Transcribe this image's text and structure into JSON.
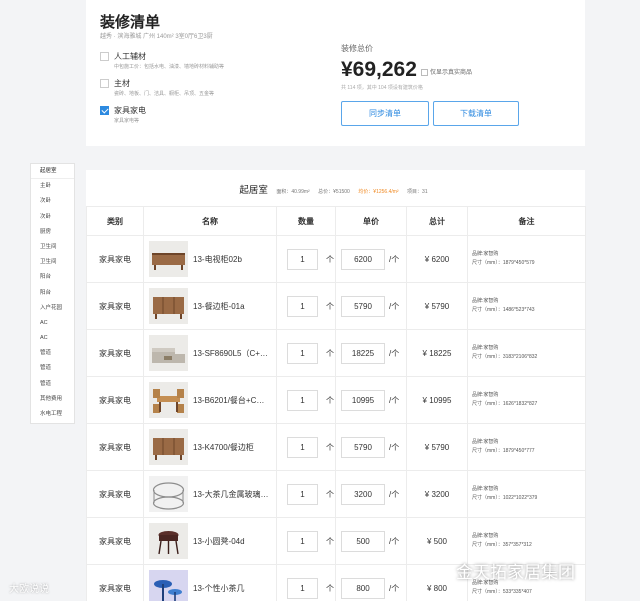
{
  "summary": {
    "title": "装修清单",
    "subtitle": "越秀 · 滨海雅城 广州 140m² 3室0厅6卫3厨",
    "options": [
      {
        "label": "人工辅材",
        "desc": "中包施工价：包括水电、油漆、墙地砖材料辅助等",
        "checked": false
      },
      {
        "label": "主材",
        "desc": "瓷砖、地板、门、洁具、橱柜、吊顶、五金等",
        "checked": false
      },
      {
        "label": "家具家电",
        "desc": "家具家电等",
        "checked": true
      }
    ],
    "total_label": "装修总价",
    "total_amount": "¥69,262",
    "show_real_label": "仅显示真实商品",
    "total_note": "共 114 项，其中 104 项设有建筑价格",
    "sync_button": "同步清单",
    "order_button": "下载清单"
  },
  "sidebar": {
    "items": [
      "起居室",
      "主卧",
      "次卧",
      "次卧",
      "厨房",
      "卫生间",
      "卫生间",
      "阳台",
      "阳台",
      "入户花园",
      "AC",
      "AC",
      "管道",
      "管道",
      "管道",
      "其他费用",
      "水电工程"
    ]
  },
  "room": {
    "title": "起居室",
    "area": "面积：40.99m²",
    "total": "总价：¥51500",
    "unit_price": "均价：¥1256.4/m²",
    "items_count": "项目：31"
  },
  "table": {
    "headers": [
      "类别",
      "名称",
      "数量",
      "单价",
      "总计",
      "备注"
    ],
    "rows": [
      {
        "category": "家具家电",
        "name": "13-电视柜02b",
        "qty": "1",
        "qty_unit": "个",
        "price": "6200",
        "price_unit": "/个",
        "total": "¥ 6200",
        "brand": "品牌:家智购",
        "size": "尺寸（mm）：1879*450*579",
        "thumb": "tv-cabinet"
      },
      {
        "category": "家具家电",
        "name": "13-餐边柜-01a",
        "qty": "1",
        "qty_unit": "个",
        "price": "5790",
        "price_unit": "/个",
        "total": "¥ 5790",
        "brand": "品牌:家智购",
        "size": "尺寸（mm）：1486*523*743",
        "thumb": "sideboard"
      },
      {
        "category": "家具家电",
        "name": "13-SF8690L5（C+…",
        "qty": "1",
        "qty_unit": "个",
        "price": "18225",
        "price_unit": "/个",
        "total": "¥ 18225",
        "brand": "品牌:家智购",
        "size": "尺寸（mm）：3183*2106*832",
        "thumb": "sofa"
      },
      {
        "category": "家具家电",
        "name": "13-B6201/餐台+C…",
        "qty": "1",
        "qty_unit": "个",
        "price": "10995",
        "price_unit": "/个",
        "total": "¥ 10995",
        "brand": "品牌:家智购",
        "size": "尺寸（mm）：1626*1832*827",
        "thumb": "dining-set"
      },
      {
        "category": "家具家电",
        "name": "13-K4700/餐边柜",
        "qty": "1",
        "qty_unit": "个",
        "price": "5790",
        "price_unit": "/个",
        "total": "¥ 5790",
        "brand": "品牌:家智购",
        "size": "尺寸（mm）：1879*450*777",
        "thumb": "sideboard"
      },
      {
        "category": "家具家电",
        "name": "13-大茶几金属玻璃…",
        "qty": "1",
        "qty_unit": "个",
        "price": "3200",
        "price_unit": "/个",
        "total": "¥ 3200",
        "brand": "品牌:家智购",
        "size": "尺寸（mm）：1022*1022*379",
        "thumb": "glass-table"
      },
      {
        "category": "家具家电",
        "name": "13-小圆凳-04d",
        "qty": "1",
        "qty_unit": "个",
        "price": "500",
        "price_unit": "/个",
        "total": "¥ 500",
        "brand": "品牌:家智购",
        "size": "尺寸（mm）：357*357*312",
        "thumb": "stool"
      },
      {
        "category": "家具家电",
        "name": "13-个性小茶几",
        "qty": "1",
        "qty_unit": "个",
        "price": "800",
        "price_unit": "/个",
        "total": "¥ 800",
        "brand": "品牌:家智购",
        "size": "尺寸（mm）：533*335*407",
        "thumb": "side-table"
      }
    ]
  },
  "watermarks": {
    "left": "大欧说说",
    "right": "金天拓家居集团"
  },
  "colors": {
    "accent": "#2d8ae0",
    "orange": "#f08a24",
    "background": "#f3f4f6"
  }
}
